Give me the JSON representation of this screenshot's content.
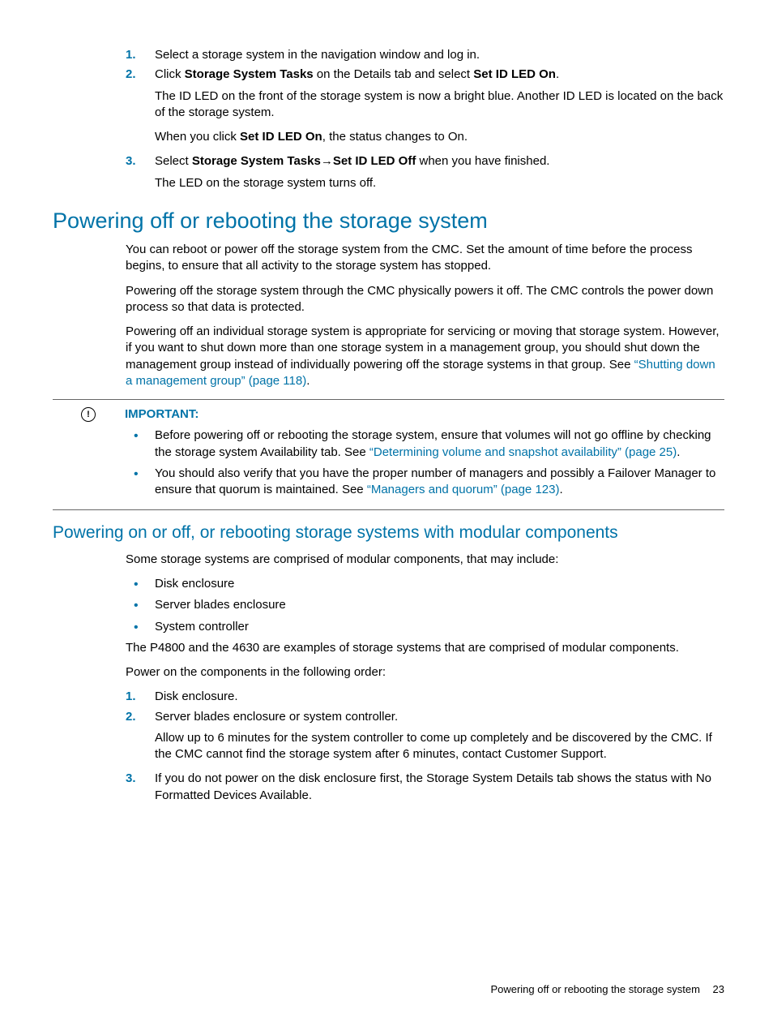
{
  "steps_top": [
    {
      "num": "1.",
      "text": "Select a storage system in the navigation window and log in."
    },
    {
      "num": "2.",
      "prefix": "Click ",
      "bold1": "Storage System Tasks",
      "mid": " on the Details tab and select ",
      "bold2": "Set ID LED On",
      "suffix": ".",
      "para1": "The ID LED on the front of the storage system is now a bright blue. Another ID LED is located on the back of the storage system.",
      "para2_pre": "When you click ",
      "para2_bold": "Set ID LED On",
      "para2_post": ", the status changes to On."
    },
    {
      "num": "3.",
      "prefix": "Select ",
      "bold1": "Storage System Tasks",
      "arrow": "→",
      "bold2": "Set ID LED Off",
      "suffix": " when you have finished.",
      "para1": "The LED on the storage system turns off."
    }
  ],
  "h2": "Powering off or rebooting the storage system",
  "p1": "You can reboot or power off the storage system from the CMC. Set the amount of time before the process begins, to ensure that all activity to the storage system has stopped.",
  "p2": "Powering off the storage system through the CMC physically powers it off. The CMC controls the power down process so that data is protected.",
  "p3_pre": "Powering off an individual storage system is appropriate for servicing or moving that storage system. However, if you want to shut down more than one storage system in a management group, you should shut down the management group instead of individually powering off the storage systems in that group. See ",
  "p3_link": "“Shutting down a management group” (page 118)",
  "p3_post": ".",
  "important": {
    "label": "IMPORTANT:",
    "b1_pre": "Before powering off or rebooting the storage system, ensure that volumes will not go offline by checking the storage system Availability tab. See ",
    "b1_link": "“Determining volume and snapshot availability” (page 25)",
    "b1_post": ".",
    "b2_pre": "You should also verify that you have the proper number of managers and possibly a Failover Manager to ensure that quorum is maintained. See ",
    "b2_link": "“Managers and quorum” (page 123)",
    "b2_post": "."
  },
  "h3": "Powering on or off, or rebooting storage systems with modular components",
  "p4": "Some storage systems are comprised of modular components, that may include:",
  "bullets2": [
    "Disk enclosure",
    "Server blades enclosure",
    "System controller"
  ],
  "p5": "The P4800 and the 4630 are examples of storage systems that are comprised of modular components.",
  "p6": "Power on the components in the following order:",
  "steps_bottom": [
    {
      "num": "1.",
      "text": "Disk enclosure."
    },
    {
      "num": "2.",
      "text": "Server blades enclosure or system controller.",
      "para1": "Allow up to 6 minutes for the system controller to come up completely and be discovered by the CMC. If the CMC cannot find the storage system after 6 minutes, contact Customer Support."
    },
    {
      "num": "3.",
      "text": "If you do not power on the disk enclosure first, the Storage System Details tab shows the status with No Formatted Devices Available."
    }
  ],
  "footer": {
    "text": "Powering off or rebooting the storage system",
    "page": "23"
  }
}
